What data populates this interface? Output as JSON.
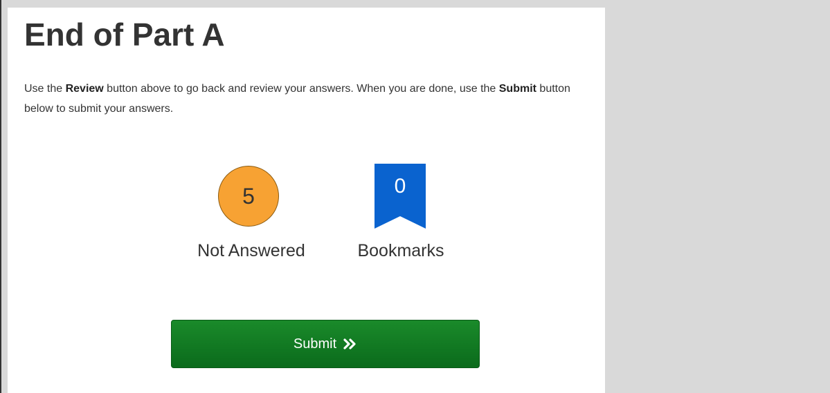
{
  "page": {
    "title": "End of Part A",
    "instructions": {
      "part1": "Use the ",
      "review_word": "Review",
      "part2": " button above to go back and review your answers. When you are done, use the ",
      "submit_word": "Submit",
      "part3": " button below to submit your answers."
    }
  },
  "stats": {
    "not_answered": {
      "count": "5",
      "label": "Not Answered",
      "color": "#f7a233"
    },
    "bookmarks": {
      "count": "0",
      "label": "Bookmarks",
      "color": "#0a63cf",
      "icon": "bookmark-icon"
    }
  },
  "actions": {
    "submit_label": "Submit",
    "submit_icon": "double-chevron-right-icon",
    "submit_color": "#0f7a22"
  }
}
